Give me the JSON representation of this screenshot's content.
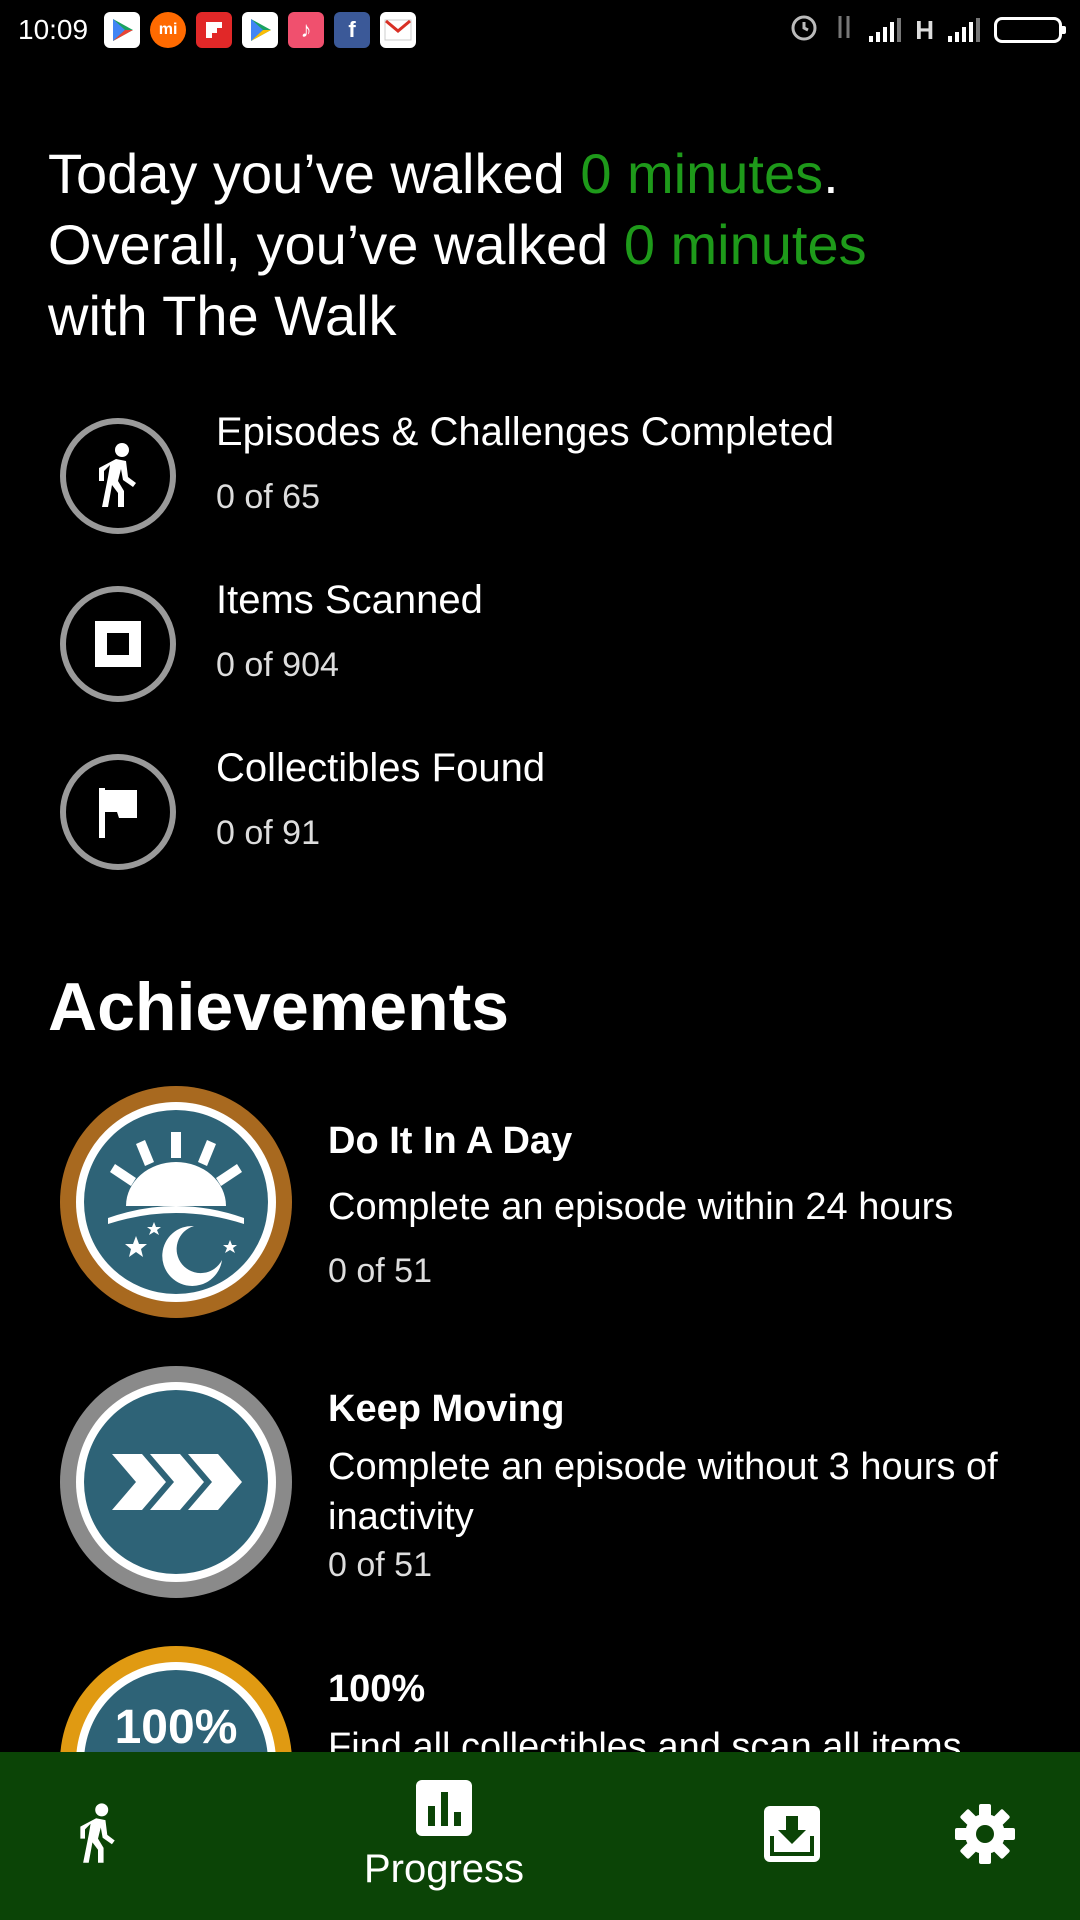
{
  "status_bar": {
    "time": "10:09",
    "network": "H",
    "app_icons": [
      "play-store-icon",
      "mi-icon",
      "flipboard-icon",
      "play-store-icon",
      "music-icon",
      "facebook-icon",
      "gmail-icon"
    ]
  },
  "summary": {
    "line1_prefix": "Today you’ve walked ",
    "line1_value": "0 minutes",
    "line1_suffix": ".",
    "line2_prefix": "Overall, you’ve walked ",
    "line2_value": "0 minutes",
    "line3": "with The Walk",
    "accent_color": "#1e9a1a"
  },
  "stats": [
    {
      "title": "Episodes & Challenges Completed",
      "value": "0 of 65",
      "icon": "walking-person-icon"
    },
    {
      "title": "Items Scanned",
      "value": "0 of 904",
      "icon": "scan-square-icon"
    },
    {
      "title": "Collectibles Found",
      "value": "0 of 91",
      "icon": "flag-icon"
    }
  ],
  "achievements_heading": "Achievements",
  "achievements": [
    {
      "title": "Do It In A Day",
      "description": "Complete an episode within 24 hours",
      "progress": "0 of 51",
      "badge": "sun-moon-badge-icon",
      "rim_color": "#a8691f"
    },
    {
      "title": "Keep Moving",
      "description": "Complete an episode without 3 hours of inactivity",
      "progress": "0 of 51",
      "badge": "chevrons-badge-icon",
      "rim_color": "#8a8a8a"
    },
    {
      "title": "100%",
      "description": "Find all collectibles and scan all items",
      "badge_text": "100%",
      "badge": "hundred-percent-badge-icon",
      "rim_color": "#e09a12"
    }
  ],
  "bottom_nav": {
    "background": "#0b4406",
    "items": [
      {
        "name": "walk",
        "icon": "walking-person-icon",
        "label": ""
      },
      {
        "name": "progress",
        "icon": "bar-chart-icon",
        "label": "Progress"
      },
      {
        "name": "downloads",
        "icon": "download-box-icon",
        "label": ""
      },
      {
        "name": "settings",
        "icon": "gear-icon",
        "label": ""
      }
    ]
  }
}
